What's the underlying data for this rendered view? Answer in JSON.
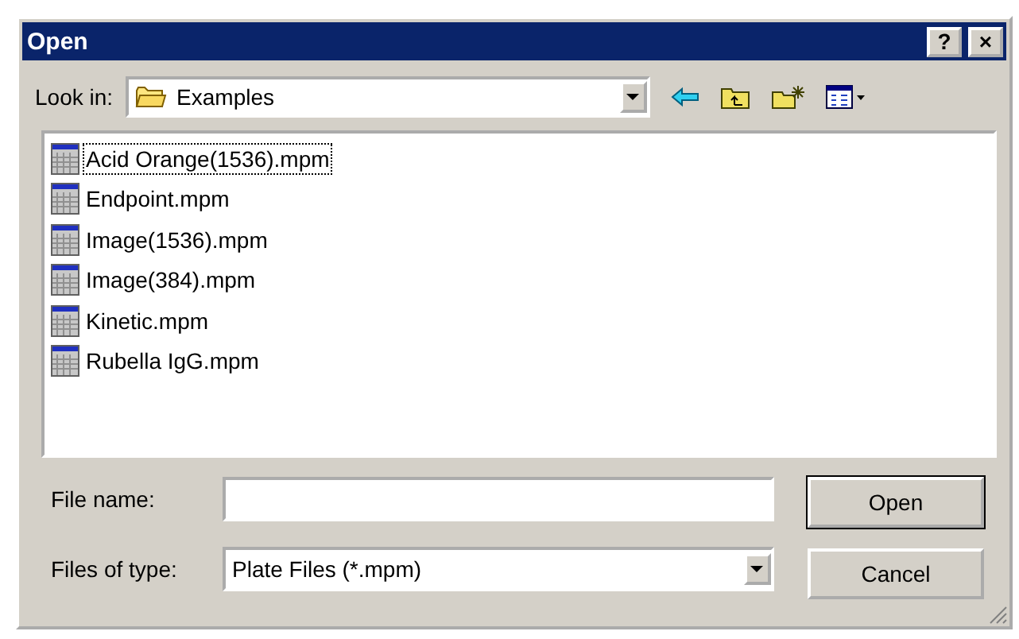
{
  "window": {
    "title": "Open",
    "help": "?",
    "close": "×"
  },
  "look_in": {
    "label": "Look in:",
    "value": "Examples"
  },
  "files": [
    {
      "name": "Acid Orange(1536).mpm",
      "focused": true
    },
    {
      "name": "Endpoint.mpm",
      "focused": false
    },
    {
      "name": "Image(1536).mpm",
      "focused": false
    },
    {
      "name": "Image(384).mpm",
      "focused": false
    },
    {
      "name": "Kinetic.mpm",
      "focused": false
    },
    {
      "name": "Rubella IgG.mpm",
      "focused": false
    }
  ],
  "file_name": {
    "label": "File name:"
  },
  "file_type": {
    "label": "Files of type:",
    "value": "Plate Files (*.mpm)"
  },
  "buttons": [
    {
      "label": "Open",
      "default": true
    },
    {
      "label": "Cancel",
      "default": false
    }
  ]
}
